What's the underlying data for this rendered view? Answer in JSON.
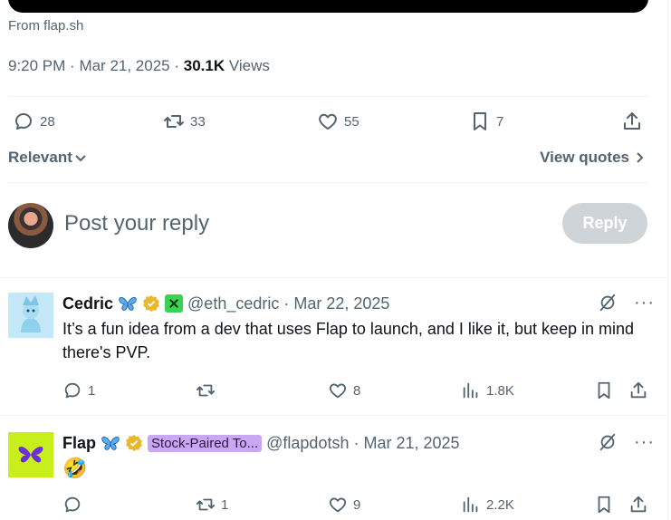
{
  "tweet": {
    "media_source": "From flap.sh",
    "time": "9:20 PM",
    "date": "Mar 21, 2025",
    "views_count": "30.1K",
    "views_label": "Views",
    "replies": "28",
    "reposts": "33",
    "likes": "55",
    "bookmarks": "7"
  },
  "sort": {
    "relevant_label": "Relevant",
    "view_quotes_label": "View quotes"
  },
  "compose": {
    "placeholder": "Post your reply",
    "reply_button": "Reply"
  },
  "replies": [
    {
      "name": "Cedric",
      "handle": "@eth_cedric",
      "date": "Mar 22, 2025",
      "text": "It’s a fun idea from a dev that uses Flap to launch, and I like it, but keep in mind there's PVP.",
      "reply_count": "1",
      "repost_count": "",
      "like_count": "8",
      "view_count": "1.8K"
    },
    {
      "name": "Flap",
      "handle": "@flapdotsh",
      "affiliation_label": "Stock-Paired To...",
      "date": "Mar 21, 2025",
      "text": "🤣",
      "reply_count": "",
      "repost_count": "1",
      "like_count": "9",
      "view_count": "2.2K"
    }
  ],
  "colors": {
    "text": "#0f1419",
    "muted": "#536471",
    "divider": "#eff3f4",
    "reply_button_disabled": "#cfd4d8",
    "verified_gold": "#e8b830",
    "flap_brand": "#c8ee1c"
  }
}
